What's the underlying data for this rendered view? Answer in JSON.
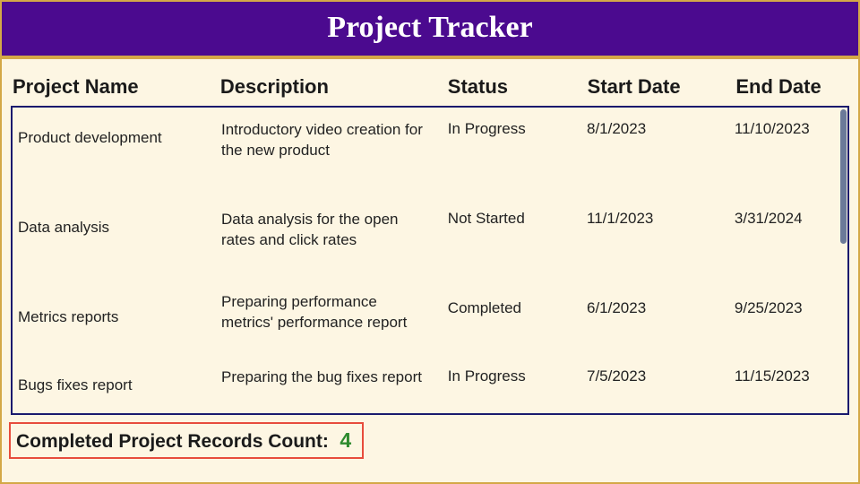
{
  "header": {
    "title": "Project Tracker"
  },
  "columns": {
    "name": "Project Name",
    "description": "Description",
    "status": "Status",
    "start": "Start Date",
    "end": "End Date"
  },
  "rows": [
    {
      "name": "Product development",
      "description": "Introductory video creation for the new product",
      "status": "In Progress",
      "start": "8/1/2023",
      "end": "11/10/2023"
    },
    {
      "name": "Data analysis",
      "description": "Data analysis for the open rates and click rates",
      "status": "Not Started",
      "start": "11/1/2023",
      "end": "3/31/2024"
    },
    {
      "name": "Metrics reports",
      "description": "Preparing performance metrics' performance report",
      "status": "Completed",
      "start": "6/1/2023",
      "end": "9/25/2023"
    },
    {
      "name": "Bugs fixes report",
      "description": "Preparing the bug fixes report",
      "status": "In Progress",
      "start": "7/5/2023",
      "end": "11/15/2023"
    }
  ],
  "counter": {
    "label": "Completed Project Records Count:",
    "value": "4"
  }
}
